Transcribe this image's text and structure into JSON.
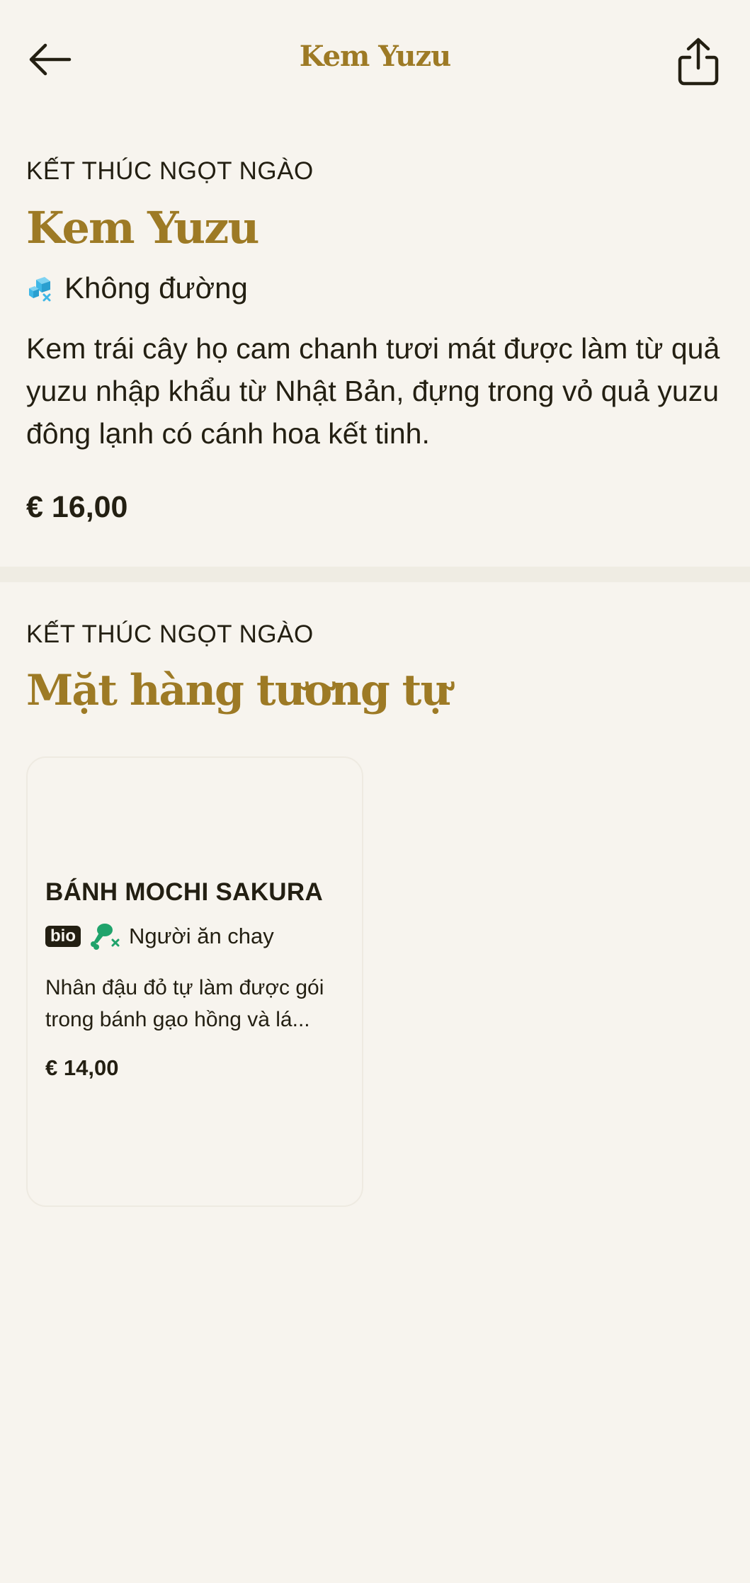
{
  "header": {
    "title": "Kem Yuzu",
    "back_icon": "arrow-left-icon",
    "share_icon": "share-upload-icon"
  },
  "product": {
    "category": "KẾT THÚC NGỌT NGÀO",
    "name": "Kem Yuzu",
    "diet_icon": "sugar-free-cube-icon",
    "diet_label": "Không đường",
    "description": "Kem trái cây họ cam chanh tươi mát được làm từ quả yuzu nhập khẩu từ Nhật Bản, đựng trong vỏ quả yuzu đông lạnh có cánh hoa kết tinh.",
    "price": "€ 16,00"
  },
  "similar": {
    "category": "KẾT THÚC NGỌT NGÀO",
    "title": "Mặt hàng tương tự",
    "items": [
      {
        "name": "BÁNH MOCHI SAKURA",
        "badge": "bio",
        "tag_icon": "vegetarian-drumstick-icon",
        "tag_label": "Người ăn chay",
        "description": "Nhân đậu đỏ tự làm được gói trong bánh gạo hồng và lá...",
        "price": "€ 14,00"
      }
    ]
  },
  "colors": {
    "background": "#f7f4ee",
    "accent_gold": "#9d7a25",
    "text_dark": "#231f12",
    "divider": "#efece3",
    "icon_blue": "#3fb7e6",
    "icon_green": "#1fa36b"
  }
}
